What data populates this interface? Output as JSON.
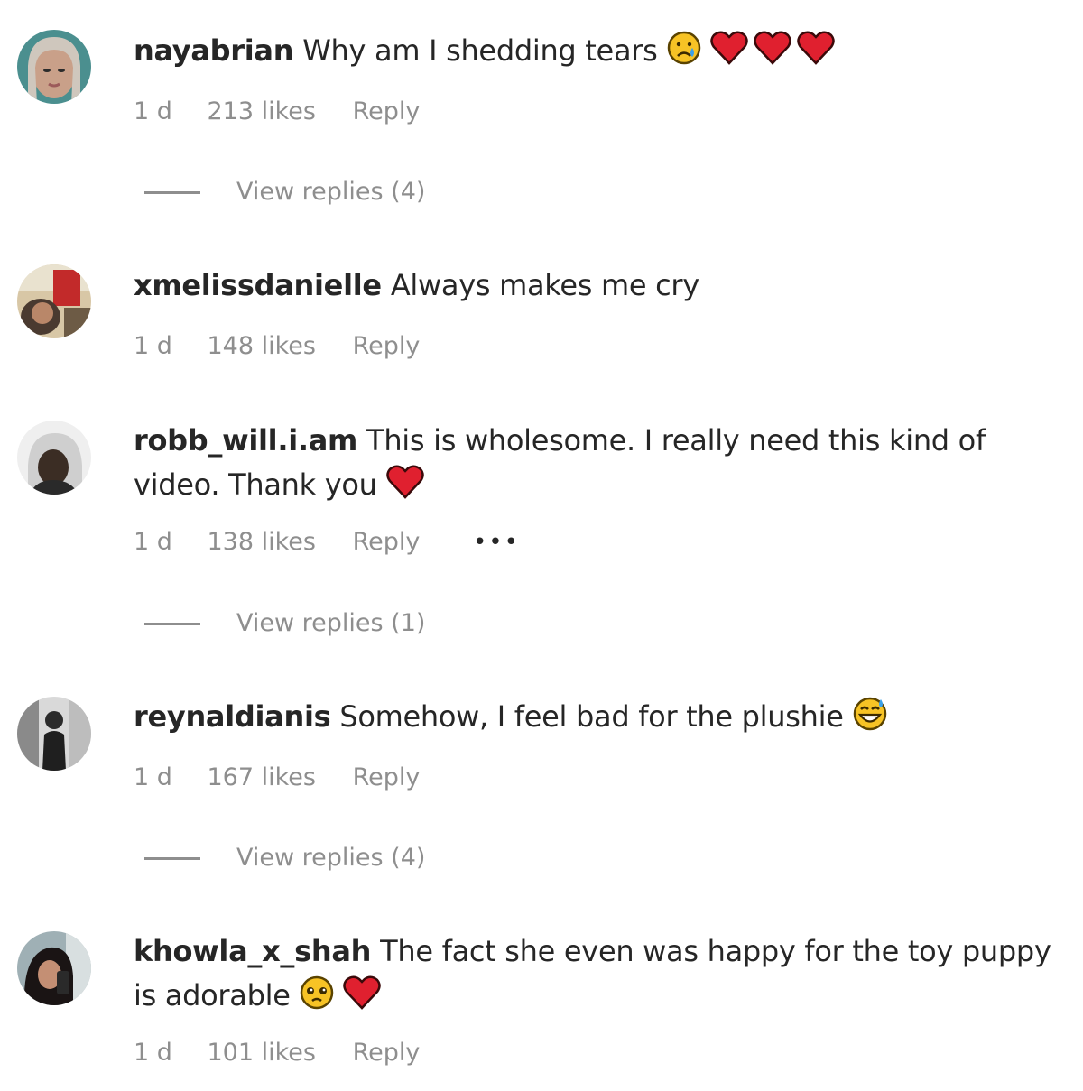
{
  "comments": [
    {
      "username": "nayabrian",
      "text": "Why am I shedding tears",
      "text2": "",
      "emojis": [
        "crying-face-emoji",
        "red-heart-emoji",
        "red-heart-emoji",
        "red-heart-emoji"
      ],
      "time": "1 d",
      "likes": "213 likes",
      "reply": "Reply",
      "view_replies": "View replies (4)"
    },
    {
      "username": "xmelissdanielle",
      "text": "Always makes me cry",
      "text2": "",
      "emojis": [],
      "time": "1 d",
      "likes": "148 likes",
      "reply": "Reply",
      "view_replies": ""
    },
    {
      "username": "robb_will.i.am",
      "text": "This is wholesome. I really need this kind of",
      "text2": "video. Thank you",
      "emojis": [
        "red-heart-emoji"
      ],
      "time": "1 d",
      "likes": "138 likes",
      "reply": "Reply",
      "more": "•••",
      "view_replies": "View replies (1)"
    },
    {
      "username": "reynaldianis",
      "text": "Somehow, I feel bad for the plushie",
      "text2": "",
      "emojis": [
        "grinning-sweat-emoji"
      ],
      "time": "1 d",
      "likes": "167 likes",
      "reply": "Reply",
      "view_replies": "View replies (4)"
    },
    {
      "username": "khowla_x_shah",
      "text": "The fact she even was happy for the toy puppy",
      "text2": "is adorable",
      "emojis": [
        "pleading-face-emoji",
        "red-heart-emoji"
      ],
      "time": "1 d",
      "likes": "101 likes",
      "reply": "Reply",
      "view_replies": ""
    }
  ],
  "colors": {
    "text": "#262626",
    "secondary": "#8e8e8e",
    "heart": "#e0202f",
    "emoji_yellow": "#f7c325"
  }
}
